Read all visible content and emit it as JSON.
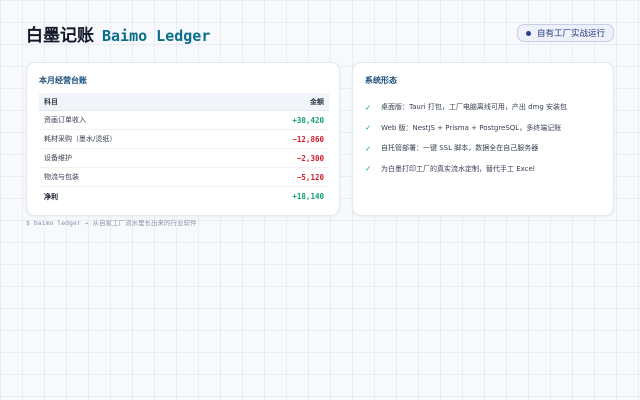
{
  "header": {
    "title_cn": "白墨记账",
    "title_en": "Baimo Ledger",
    "badge": "自有工厂实战运行"
  },
  "ledger": {
    "title": "本月经营台账",
    "col_item": "科目",
    "col_amount": "金额",
    "rows": [
      {
        "item": "资画订单收入",
        "amount": "+38,420",
        "sign": "pos"
      },
      {
        "item": "耗材采购（墨水/烫纸）",
        "amount": "−12,860",
        "sign": "neg"
      },
      {
        "item": "设备维护",
        "amount": "−2,300",
        "sign": "neg"
      },
      {
        "item": "物流与包装",
        "amount": "−5,120",
        "sign": "neg"
      },
      {
        "item": "净利",
        "amount": "+18,140",
        "sign": "pos"
      }
    ]
  },
  "system": {
    "title": "系统形态",
    "check_icon": "✓",
    "features": [
      "桌面版：Tauri 打包，工厂电脑离线可用，产出 dmg 安装包",
      "Web 版：NestJS + Prisma + PostgreSQL，多终端记账",
      "自托管部署：一键 SSL 脚本，数据全在自己服务器",
      "为白墨打印工厂的真实流水定制，替代手工 Excel"
    ]
  },
  "footer": {
    "text": "$ baimo ledger → 从自家工厂流水里长出来的行业软件"
  },
  "colors": {
    "accent": "#0b6e8a",
    "positive": "#0e9f6e",
    "negative": "#d11a2a",
    "card_title": "#1b4f7a"
  }
}
